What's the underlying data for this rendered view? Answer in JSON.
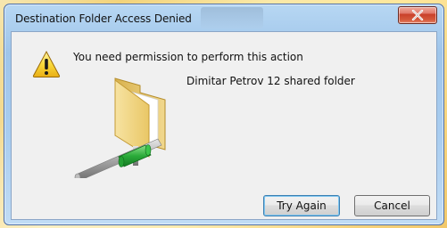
{
  "dialog": {
    "title": "Destination Folder Access Denied",
    "message": "You need permission to perform this action",
    "folder_name": "Dimitar Petrov 12 shared folder",
    "buttons": {
      "try_again": "Try Again",
      "cancel": "Cancel"
    },
    "icons": {
      "warning": "warning-icon",
      "close": "close-icon",
      "folder": "shared-folder-icon"
    }
  },
  "colors": {
    "close_button": "#c9402a",
    "client_background": "#f0f0f0",
    "default_button_border": "#3c7fb1",
    "folder_yellow": "#f2d27a",
    "network_green": "#2bab3a"
  }
}
